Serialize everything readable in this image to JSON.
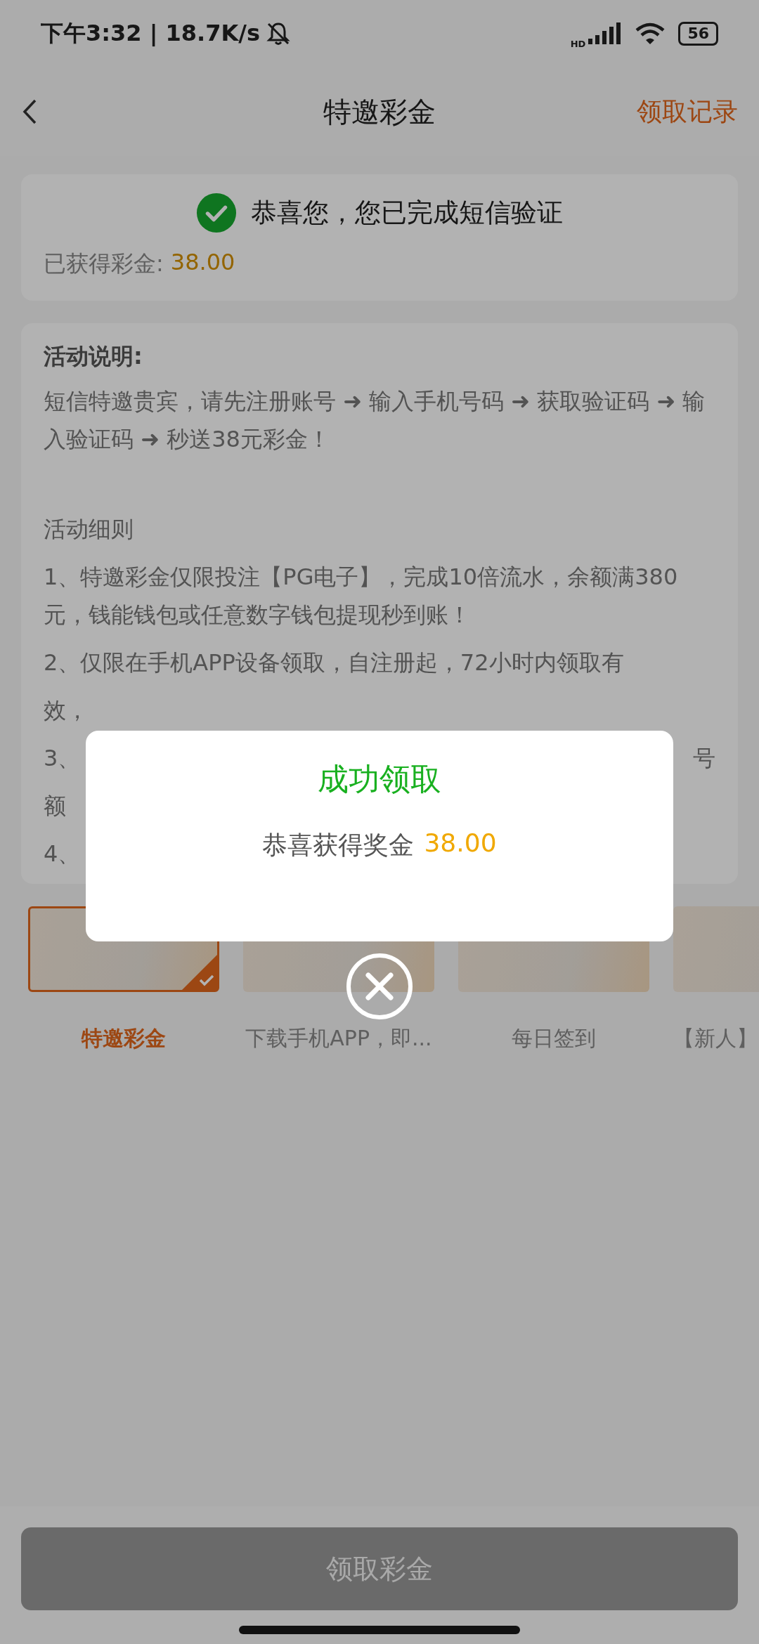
{
  "status_bar": {
    "time": "下午3:32 | 18.7K/s",
    "battery": "56",
    "network": "HD"
  },
  "header": {
    "title": "特邀彩金",
    "action": "领取记录"
  },
  "status_card": {
    "message": "恭喜您，您已完成短信验证",
    "earned_label": "已获得彩金:",
    "earned_amount": "38.00"
  },
  "info_card": {
    "heading": "活动说明:",
    "intro": "短信特邀贵宾，请先注册账号 ➜ 输入手机号码 ➜ 获取验证码 ➜ 输入验证码 ➜ 秒送38元彩金！",
    "rules_heading": "活动细则",
    "rules": [
      {
        "text": "1、特邀彩金仅限投注【PG电子】，完成10倍流水，余额满380元，钱能钱包或任意数字钱包提现秒到账！"
      }
    ],
    "partial_lines": [
      {
        "left": "2、仅限在手机APP设备领取，自注册起，72小时内领取有"
      },
      {
        "left": "效，"
      },
      {
        "left": "3、",
        "right": "号"
      },
      {
        "left": "额"
      },
      {
        "left": "4、"
      }
    ]
  },
  "promotions": [
    {
      "label": "特邀彩金",
      "selected": true
    },
    {
      "label": "下载手机APP，即...",
      "selected": false
    },
    {
      "label": "每日签到",
      "selected": false
    },
    {
      "label": "【新人】",
      "selected": false
    }
  ],
  "claim_button": {
    "label": "领取彩金",
    "disabled": true
  },
  "dialog": {
    "title": "成功领取",
    "message": "恭喜获得奖金",
    "amount": "38.00"
  }
}
